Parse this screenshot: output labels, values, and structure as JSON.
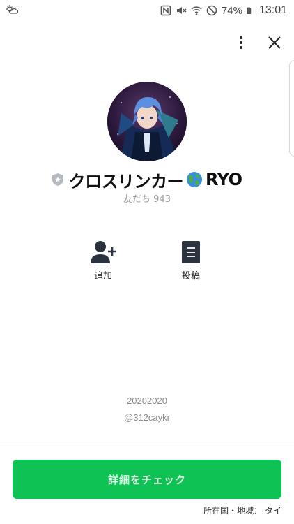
{
  "status_bar": {
    "battery_percent": "74%",
    "time": "13:01"
  },
  "profile": {
    "name": "クロスリンカー",
    "name_suffix": "RYO",
    "friends_label": "友だち 943",
    "status_message": "20202020",
    "user_id": "@312caykr"
  },
  "actions": {
    "add_label": "追加",
    "post_label": "投稿"
  },
  "cta": {
    "label": "詳細をチェック"
  },
  "footer": {
    "region_label": "所在国・地域： タイ"
  },
  "colors": {
    "accent": "#0fc254",
    "muted_text": "#8c8c8c"
  },
  "icons": {
    "left_status": "weather-icon",
    "nfc": "nfc-icon",
    "mute": "mute-icon",
    "wifi": "wifi-icon",
    "dnd": "do-not-disturb-icon",
    "battery": "battery-icon",
    "more": "more-vert-icon",
    "close": "close-icon",
    "shield": "official-shield-icon",
    "globe": "globe-icon",
    "add": "add-friend-icon",
    "post": "post-icon"
  }
}
